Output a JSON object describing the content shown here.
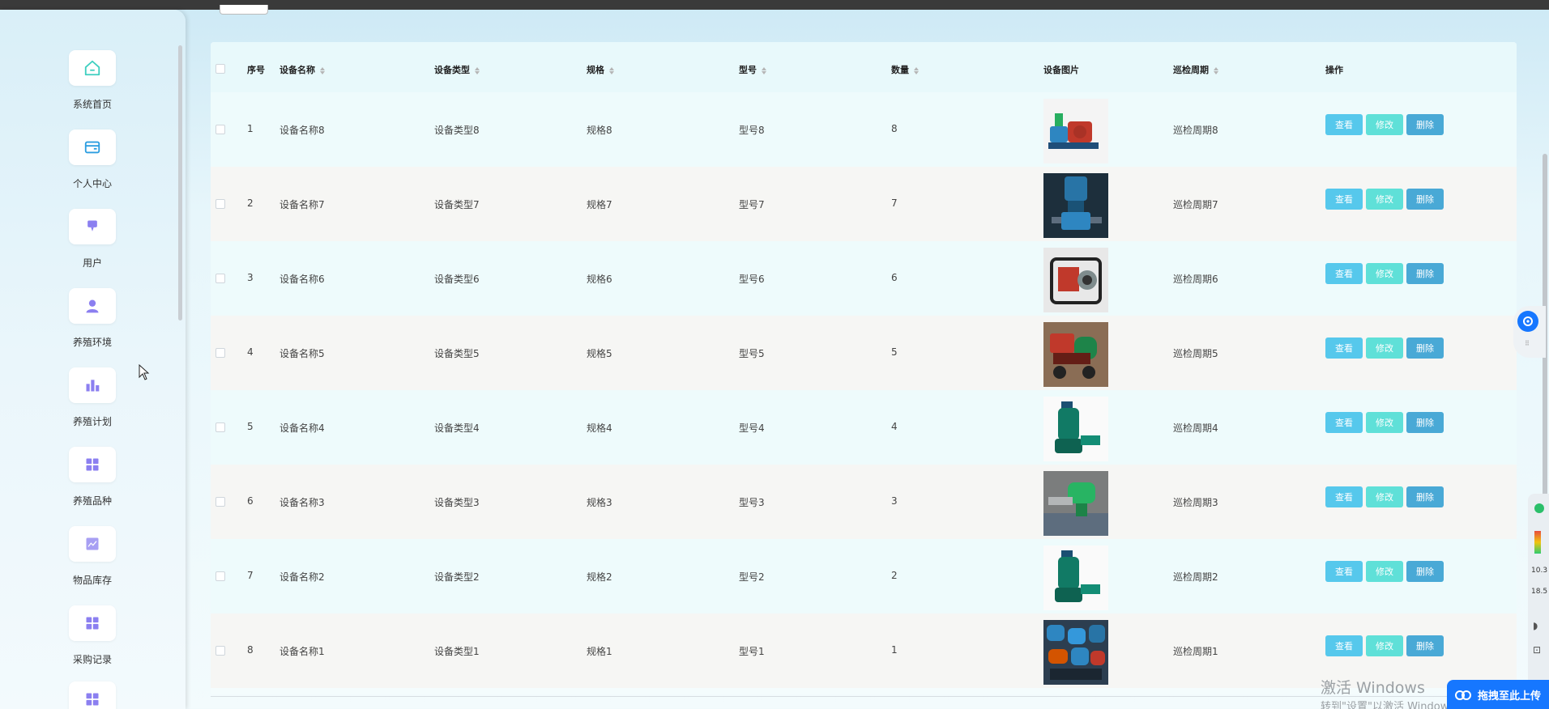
{
  "sidebar": {
    "items": [
      {
        "label": "系统首页",
        "icon": "home-icon"
      },
      {
        "label": "个人中心",
        "icon": "card-icon"
      },
      {
        "label": "用户",
        "icon": "user-tag-icon"
      },
      {
        "label": "养殖环境",
        "icon": "person-icon"
      },
      {
        "label": "养殖计划",
        "icon": "bar-chart-icon"
      },
      {
        "label": "养殖品种",
        "icon": "grid-icon"
      },
      {
        "label": "物品库存",
        "icon": "line-chart-icon"
      },
      {
        "label": "采购记录",
        "icon": "grid-icon"
      },
      {
        "label": "",
        "icon": "grid-icon"
      }
    ]
  },
  "table": {
    "columns": [
      "序号",
      "设备名称",
      "设备类型",
      "规格",
      "型号",
      "数量",
      "设备图片",
      "巡检周期",
      "操作"
    ],
    "rows": [
      {
        "index": "1",
        "name": "设备名称8",
        "type": "设备类型8",
        "spec": "规格8",
        "model": "型号8",
        "qty": "8",
        "cycle": "巡检周期8",
        "image": "pump-red-blue"
      },
      {
        "index": "2",
        "name": "设备名称7",
        "type": "设备类型7",
        "spec": "规格7",
        "model": "型号7",
        "qty": "7",
        "cycle": "巡检周期7",
        "image": "vertical-pump-blue"
      },
      {
        "index": "3",
        "name": "设备名称6",
        "type": "设备类型6",
        "spec": "规格6",
        "model": "型号6",
        "qty": "6",
        "cycle": "巡检周期6",
        "image": "engine-pump-frame"
      },
      {
        "index": "4",
        "name": "设备名称5",
        "type": "设备类型5",
        "spec": "规格5",
        "model": "型号5",
        "qty": "5",
        "cycle": "巡检周期5",
        "image": "diesel-pump-red"
      },
      {
        "index": "5",
        "name": "设备名称4",
        "type": "设备类型4",
        "spec": "规格4",
        "model": "型号4",
        "qty": "4",
        "cycle": "巡检周期4",
        "image": "submersible-pump-green"
      },
      {
        "index": "6",
        "name": "设备名称3",
        "type": "设备类型3",
        "spec": "规格3",
        "model": "型号3",
        "qty": "3",
        "cycle": "巡检周期3",
        "image": "pump-green-installed"
      },
      {
        "index": "7",
        "name": "设备名称2",
        "type": "设备类型2",
        "spec": "规格2",
        "model": "型号2",
        "qty": "2",
        "cycle": "巡检周期2",
        "image": "submersible-pump-green"
      },
      {
        "index": "8",
        "name": "设备名称1",
        "type": "设备类型1",
        "spec": "规格1",
        "model": "型号1",
        "qty": "1",
        "cycle": "巡检周期1",
        "image": "pumps-warehouse"
      }
    ],
    "actions": {
      "view": "查看",
      "edit": "修改",
      "delete": "删除"
    }
  },
  "perf_widget": {
    "value1": "10.3",
    "value2": "18.5"
  },
  "watermark": {
    "line1": "激活 Windows",
    "line2": "转到\"设置\"以激活 Windows。"
  },
  "upload": {
    "label": "拖拽至此上传"
  },
  "colors": {
    "view": "#56c8ec",
    "edit": "#5fe0d8",
    "delete": "#49a9d6",
    "accent": "#1677ff"
  }
}
